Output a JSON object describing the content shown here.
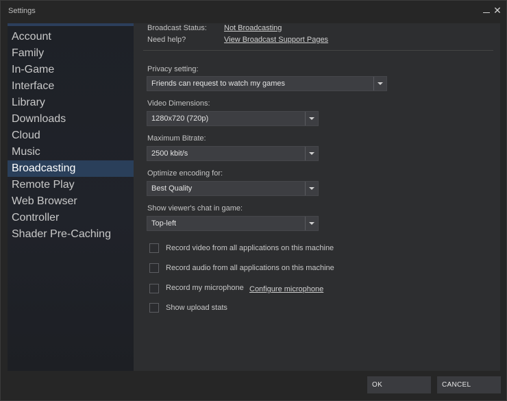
{
  "window": {
    "title": "Settings",
    "minimize_icon": "minimize-icon",
    "close_icon": "close-icon"
  },
  "sidebar": {
    "items": [
      {
        "label": "Account",
        "active": false
      },
      {
        "label": "Family",
        "active": false
      },
      {
        "label": "In-Game",
        "active": false
      },
      {
        "label": "Interface",
        "active": false
      },
      {
        "label": "Library",
        "active": false
      },
      {
        "label": "Downloads",
        "active": false
      },
      {
        "label": "Cloud",
        "active": false
      },
      {
        "label": "Music",
        "active": false
      },
      {
        "label": "Broadcasting",
        "active": true
      },
      {
        "label": "Remote Play",
        "active": false
      },
      {
        "label": "Web Browser",
        "active": false
      },
      {
        "label": "Controller",
        "active": false
      },
      {
        "label": "Shader Pre-Caching",
        "active": false
      }
    ],
    "active_color": "#2a3f5a"
  },
  "broadcast": {
    "status_label": "Broadcast Status:",
    "status_value": "Not Broadcasting",
    "help_label": "Need help?",
    "help_link": "View Broadcast Support Pages"
  },
  "settings": {
    "privacy": {
      "label": "Privacy setting:",
      "value": "Friends can request to watch my games"
    },
    "dimensions": {
      "label": "Video Dimensions:",
      "value": "1280x720 (720p)"
    },
    "bitrate": {
      "label": "Maximum Bitrate:",
      "value": "2500 kbit/s"
    },
    "encoding": {
      "label": "Optimize encoding for:",
      "value": "Best Quality"
    },
    "chat": {
      "label": "Show viewer's chat in game:",
      "value": "Top-left"
    }
  },
  "checkboxes": {
    "record_video": {
      "label": "Record video from all applications on this machine",
      "checked": false
    },
    "record_audio": {
      "label": "Record audio from all applications on this machine",
      "checked": false
    },
    "record_mic": {
      "label": "Record my microphone",
      "checked": false,
      "link": "Configure microphone"
    },
    "upload_stats": {
      "label": "Show upload stats",
      "checked": false
    }
  },
  "footer": {
    "ok_label": "OK",
    "cancel_label": "CANCEL"
  }
}
